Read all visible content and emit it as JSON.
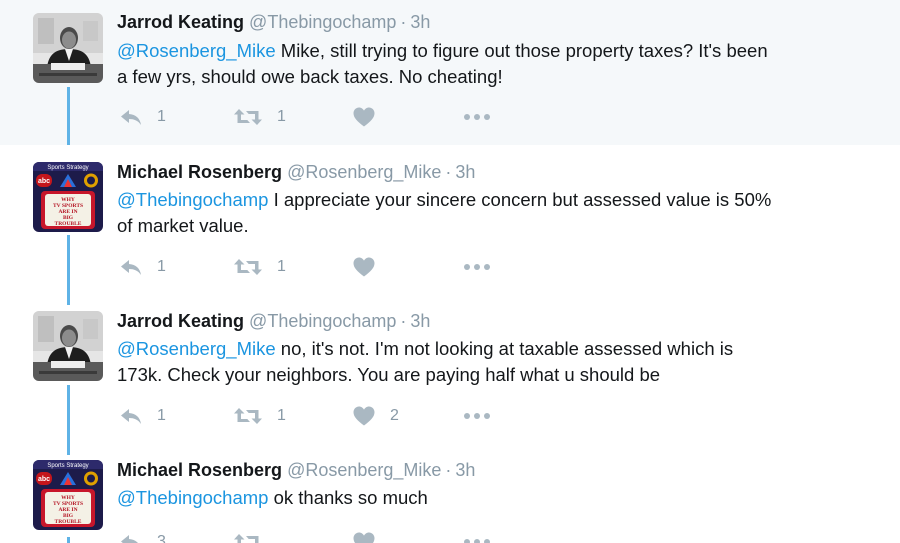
{
  "tweets": [
    {
      "name": "Jarrod Keating",
      "handle": "@Thebingochamp",
      "time": "3h",
      "mention": "@Rosenberg_Mike",
      "text_line1": " Mike, still trying to figure out those property taxes? It's been",
      "text_line2": "a few yrs, should owe back taxes. No cheating!",
      "replies": "1",
      "retweets": "1",
      "likes": "",
      "avatar": "man-at-desk-photo"
    },
    {
      "name": "Michael Rosenberg",
      "handle": "@Rosenberg_Mike",
      "time": "3h",
      "mention": "@Thebingochamp",
      "text_line1": " I appreciate your sincere concern but assessed value is 50%",
      "text_line2": "of market value.",
      "replies": "1",
      "retweets": "1",
      "likes": "",
      "avatar": "tv-sports-book-cover"
    },
    {
      "name": "Jarrod Keating",
      "handle": "@Thebingochamp",
      "time": "3h",
      "mention": "@Rosenberg_Mike",
      "text_line1": " no, it's not. I'm not looking at taxable assessed which is",
      "text_line2": "173k. Check your neighbors. You are paying half what u should be",
      "replies": "1",
      "retweets": "1",
      "likes": "2",
      "avatar": "man-at-desk-photo"
    },
    {
      "name": "Michael Rosenberg",
      "handle": "@Rosenberg_Mike",
      "time": "3h",
      "mention": "@Thebingochamp",
      "text_line1": " ok thanks so much",
      "text_line2": "",
      "replies": "3",
      "retweets": "",
      "likes": "",
      "avatar": "tv-sports-book-cover"
    }
  ],
  "icons": {
    "reply": "reply-icon",
    "retweet": "retweet-icon",
    "like": "heart-icon",
    "more": "more-icon"
  },
  "colors": {
    "mention": "#1b95e0",
    "thread_line": "#5fb3e6",
    "highlight_bg": "#f5f8fa",
    "icon": "#aab8c2",
    "meta": "#8899a6"
  },
  "book_cover": {
    "top_banner": "Sports Strategy",
    "logos": [
      "abc",
      "NBC",
      "CBS"
    ],
    "title_lines": [
      "WHY",
      "TV SPORTS",
      "ARE IN",
      "BIG",
      "TROUBLE"
    ]
  }
}
